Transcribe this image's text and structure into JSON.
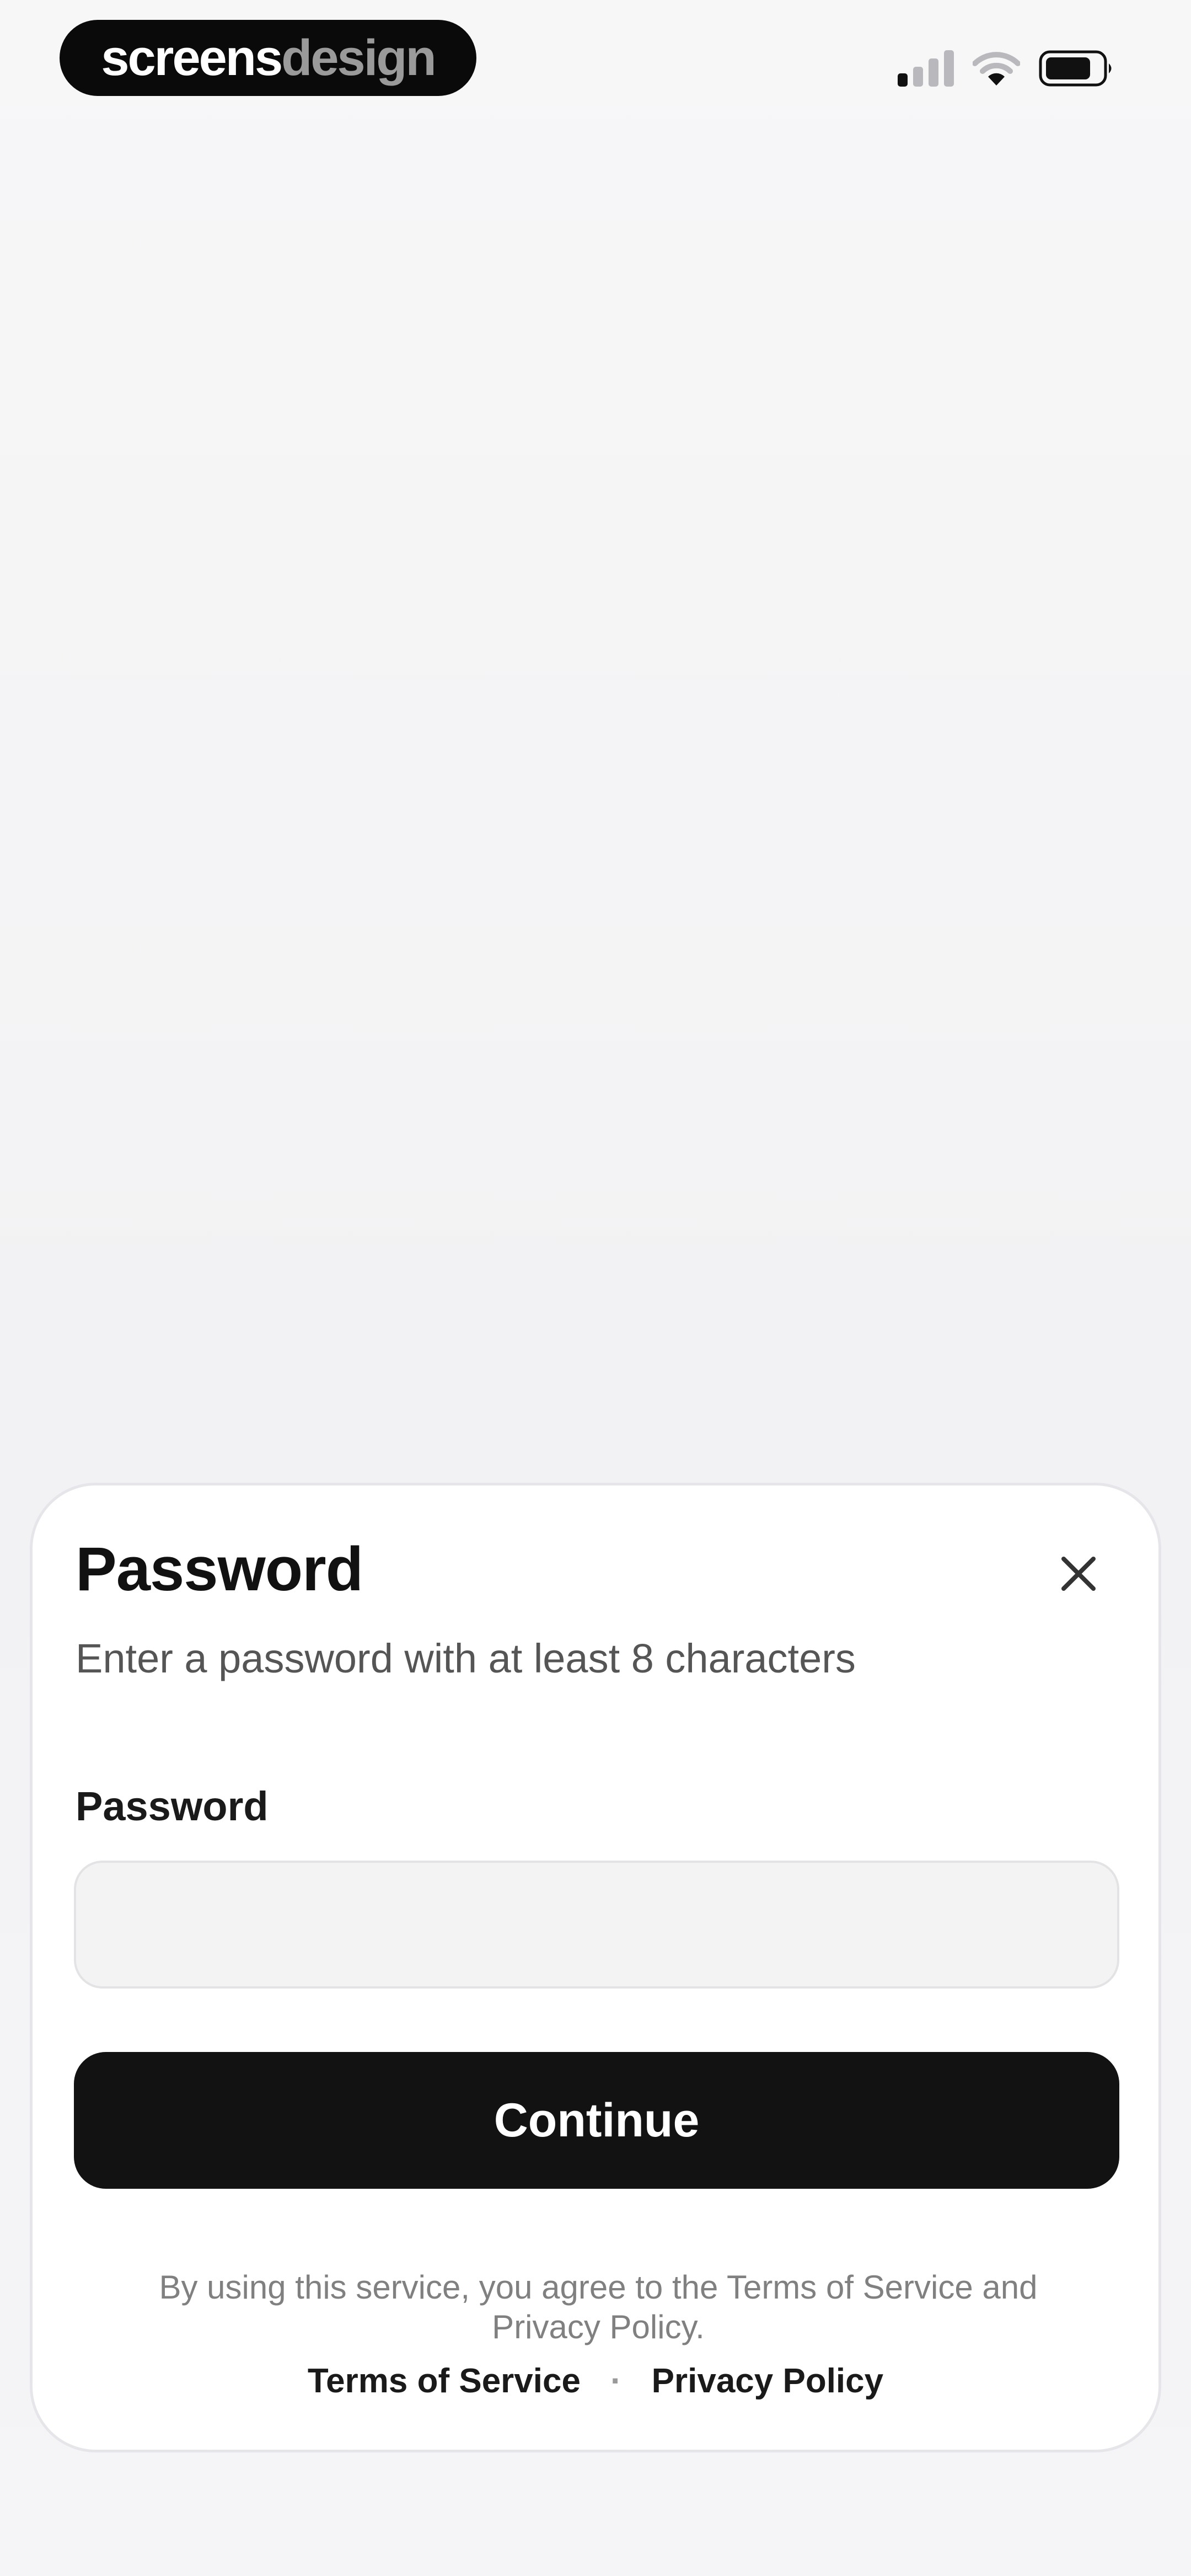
{
  "watermark": {
    "part1": "screens",
    "part2": "design"
  },
  "status_bar": {
    "icons": [
      "cellular-signal-icon",
      "wifi-icon",
      "battery-icon"
    ]
  },
  "sheet": {
    "title": "Password",
    "subtitle": "Enter a password with at least 8 characters",
    "close_icon": "close-icon",
    "field_label": "Password",
    "input_value": "",
    "continue_label": "Continue",
    "legal_text": "By using this service, you agree to the Terms of Service and Privacy Policy.",
    "links": {
      "terms": "Terms of Service",
      "separator": "·",
      "privacy": "Privacy Policy"
    }
  },
  "colors": {
    "background": "#f4f4f6",
    "sheet": "#ffffff",
    "button": "#121212",
    "button_text": "#ffffff",
    "input_fill": "#f3f3f4",
    "muted_text": "#808080"
  }
}
